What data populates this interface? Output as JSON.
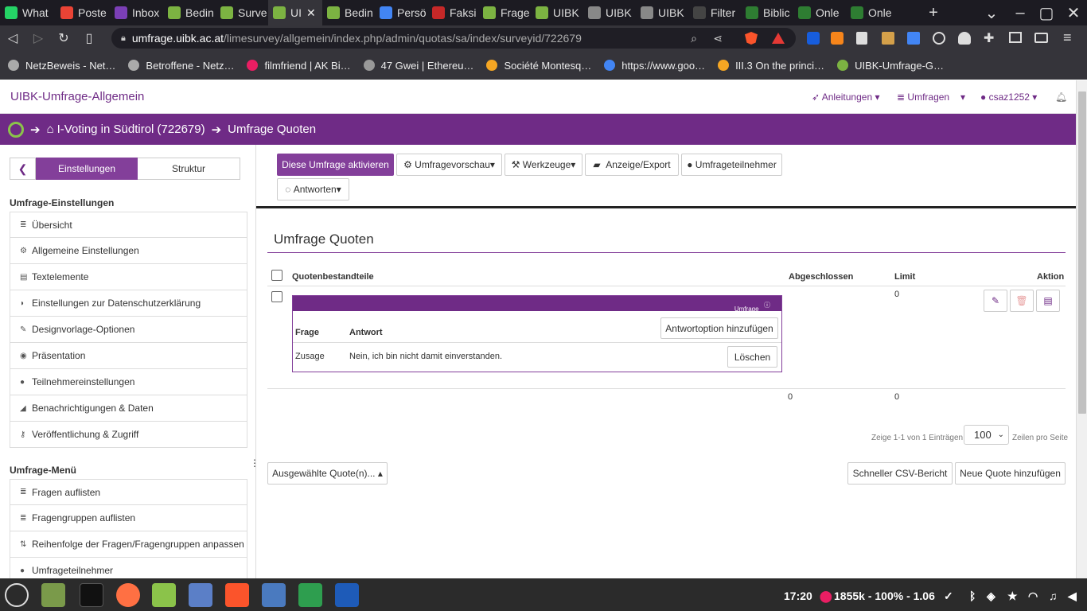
{
  "browser": {
    "tabs": [
      {
        "label": "What",
        "color": "#25d366"
      },
      {
        "label": "Poste",
        "color": "#ea4335"
      },
      {
        "label": "Inbox",
        "color": "#7b3fb6"
      },
      {
        "label": "Bedin",
        "color": "#7cb342"
      },
      {
        "label": "Surve",
        "color": "#7cb342"
      },
      {
        "label": "UI",
        "color": "#7cb342",
        "active": true
      },
      {
        "label": "Bedin",
        "color": "#7cb342"
      },
      {
        "label": "Persö",
        "color": "#4285f4"
      },
      {
        "label": "Faksi",
        "color": "#c62828"
      },
      {
        "label": "Frage",
        "color": "#7cb342"
      },
      {
        "label": "UIBK",
        "color": "#7cb342"
      },
      {
        "label": "UIBK",
        "color": "#888888"
      },
      {
        "label": "UIBK",
        "color": "#888888"
      },
      {
        "label": "Filter",
        "color": "#444444"
      },
      {
        "label": "Biblic",
        "color": "#2e7d32"
      },
      {
        "label": "Onle",
        "color": "#2e7d32"
      },
      {
        "label": "Onle",
        "color": "#2e7d32"
      }
    ],
    "url_host": "umfrage.uibk.ac.at",
    "url_path": "/limesurvey/allgemein/index.php/admin/quotas/sa/index/surveyid/722679",
    "bookmarks": [
      {
        "label": "NetzBeweis - Net…",
        "color": "#aaaaaa"
      },
      {
        "label": "Betroffene - Netz…",
        "color": "#aaaaaa"
      },
      {
        "label": "filmfriend | AK Bi…",
        "color": "#e91e63"
      },
      {
        "label": "47 Gwei | Ethereu…",
        "color": "#999999"
      },
      {
        "label": "Société Montesq…",
        "color": "#f5a623"
      },
      {
        "label": "https://www.goo…",
        "color": "#4285f4"
      },
      {
        "label": "III.3 On the princi…",
        "color": "#f5a623"
      },
      {
        "label": "UIBK-Umfrage-G…",
        "color": "#7cb342"
      }
    ]
  },
  "app": {
    "brand": "UIBK-Umfrage-Allgemein",
    "nav_guides": "Anleitungen",
    "nav_surveys": "Umfragen",
    "nav_user": "csaz1252",
    "breadcrumb_survey": "I-Voting in Südtirol (722679)",
    "breadcrumb_page": "Umfrage Quoten"
  },
  "sidebar": {
    "tab_settings": "Einstellungen",
    "tab_structure": "Struktur",
    "section_settings": "Umfrage-Einstellungen",
    "settings_items": [
      {
        "icon": "≣",
        "label": "Übersicht"
      },
      {
        "icon": "⚙",
        "label": "Allgemeine Einstellungen"
      },
      {
        "icon": "▤",
        "label": "Textelemente"
      },
      {
        "icon": "◗",
        "label": "Einstellungen zur Datenschutzerklärung"
      },
      {
        "icon": "✎",
        "label": "Designvorlage-Optionen"
      },
      {
        "icon": "◉",
        "label": "Präsentation"
      },
      {
        "icon": "●",
        "label": "Teilnehmereinstellungen"
      },
      {
        "icon": "◢",
        "label": "Benachrichtigungen & Daten"
      },
      {
        "icon": "⚷",
        "label": "Veröffentlichung & Zugriff"
      }
    ],
    "section_menu": "Umfrage-Menü",
    "menu_items": [
      {
        "icon": "≣",
        "label": "Fragen auflisten"
      },
      {
        "icon": "≣",
        "label": "Fragengruppen auflisten"
      },
      {
        "icon": "⇅",
        "label": "Reihenfolge der Fragen/Fragengruppen anpassen"
      },
      {
        "icon": "●",
        "label": "Umfrageteilnehmer"
      }
    ]
  },
  "toolbar": {
    "activate": "Diese Umfrage aktivieren",
    "preview": "Umfragevorschau",
    "tools": "Werkzeuge",
    "display_export": "Anzeige/Export",
    "participants": "Umfrageteilnehmer",
    "responses": "Antworten"
  },
  "quotas": {
    "title": "Umfrage Quoten",
    "col_members": "Quotenbestandteile",
    "col_completed": "Abgeschlossen",
    "col_limit": "Limit",
    "col_action": "Aktion",
    "quota_action": "Umfrage beenden",
    "col_question": "Frage",
    "col_answer": "Antwort",
    "add_answer": "Antwortoption hinzufügen",
    "row_question": "Zusage",
    "row_answer": "Nein, ich bin nicht damit einverstanden.",
    "delete": "Löschen",
    "row_limit": "0",
    "total_completed": "0",
    "total_limit": "0",
    "pager_text": "Zeige 1-1 von 1 Einträgen.",
    "page_size": "100",
    "page_size_suffix": "Zeilen pro Seite",
    "selected_quotas": "Ausgewählte Quote(n)...",
    "csv_report": "Schneller CSV-Bericht",
    "new_quota": "Neue Quote hinzufügen"
  },
  "taskbar": {
    "time": "17:20",
    "status": "1855k - 100% - 1.06"
  }
}
